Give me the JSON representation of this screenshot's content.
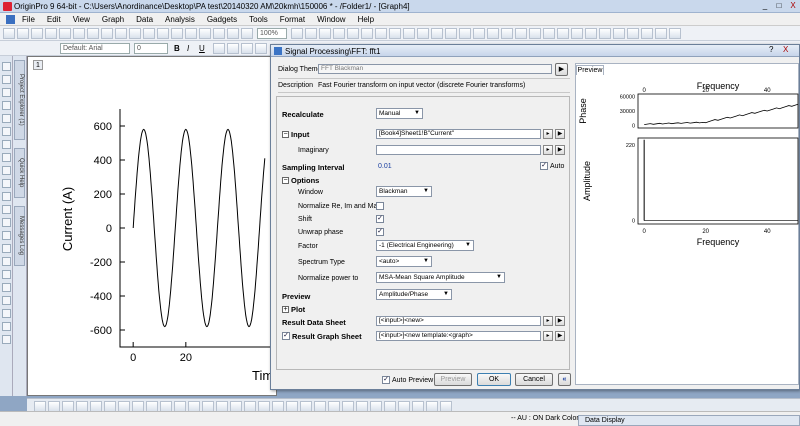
{
  "app": {
    "title": "OriginPro 9 64-bit - C:\\Users\\Anordinance\\Desktop\\PA test\\20140320 AM\\20kmh\\150006 * - /Folder1/ - [Graph4]",
    "min_label": "_",
    "max_label": "□",
    "close_label": "X"
  },
  "menu": [
    "File",
    "Edit",
    "View",
    "Graph",
    "Data",
    "Analysis",
    "Gadgets",
    "Tools",
    "Format",
    "Window",
    "Help"
  ],
  "toolbar": {
    "zoom": "100%",
    "font": "Default: Arial",
    "font_size": "0",
    "bold": "B",
    "italic": "I",
    "underline": "U"
  },
  "side_tabs": [
    "Project Explorer (1)",
    "Quick Help",
    "Messages Log"
  ],
  "graph": {
    "page_number": "1",
    "yticks": [
      "600",
      "400",
      "200",
      "0",
      "-200",
      "-400",
      "-600"
    ],
    "xticks": [
      "0",
      "20"
    ],
    "ylabel": "Current (A)",
    "xlabel": "Tim"
  },
  "dialog": {
    "title": "Signal Processing\\FFT: fft1",
    "theme_label": "Dialog Theme",
    "theme_value": "FFT Blackman",
    "description_label": "Description",
    "description_value": "Fast Fourier transform on input vector (discrete Fourier transforms)",
    "recalculate_label": "Recalculate",
    "recalculate_value": "Manual",
    "input_label": "Input",
    "input_value": "[Book4]Sheet1!B\"Current\"",
    "imaginary_label": "Imaginary",
    "imaginary_value": "",
    "sampling_label": "Sampling Interval",
    "sampling_value": "0.01",
    "auto_label": "Auto",
    "options_label": "Options",
    "window_label": "Window",
    "window_value": "Blackman",
    "normalize_label": "Normalize Re, Im and Mag",
    "shift_label": "Shift",
    "unwrap_label": "Unwrap phase",
    "factor_label": "Factor",
    "factor_value": "-1 (Electrical Engineering)",
    "spectrum_label": "Spectrum Type",
    "spectrum_value": "<auto>",
    "normpower_label": "Normalize power to",
    "normpower_value": "MSA-Mean Square Amplitude",
    "preview_label": "Preview",
    "preview_value": "Amplitude/Phase",
    "plot_label": "Plot",
    "result_data_label": "Result Data Sheet",
    "result_data_value": "[<input>]<new>",
    "result_graph_label": "Result Graph Sheet",
    "result_graph_value": "[<input>]<new template:<graph>",
    "auto_preview_label": "Auto Preview",
    "preview_btn": "Preview",
    "ok_btn": "OK",
    "cancel_btn": "Cancel",
    "collapse_btn": "«",
    "preview_tab": "Preview",
    "menu_arrow": "▶",
    "picker": "▸",
    "dropdown": "▼",
    "check": "✓",
    "minus": "−",
    "plus": "+"
  },
  "preview_chart": {
    "top_xlabel": "Frequency",
    "top_ylabel": "Phase",
    "top_xticks": [
      "0",
      "20",
      "40"
    ],
    "top_yticks": [
      "60000",
      "30000",
      "0"
    ],
    "bottom_xlabel": "Frequency",
    "bottom_ylabel": "Amplitude",
    "bottom_xticks": [
      "0",
      "20",
      "40"
    ],
    "bottom_yticks": [
      "220",
      "0"
    ]
  },
  "status": {
    "text": "-- AU : ON  Dark Colors & ...",
    "data_display": "Data Display"
  },
  "colors": {
    "accent": "#3b74c5",
    "chrome": "#c9d8ec"
  }
}
